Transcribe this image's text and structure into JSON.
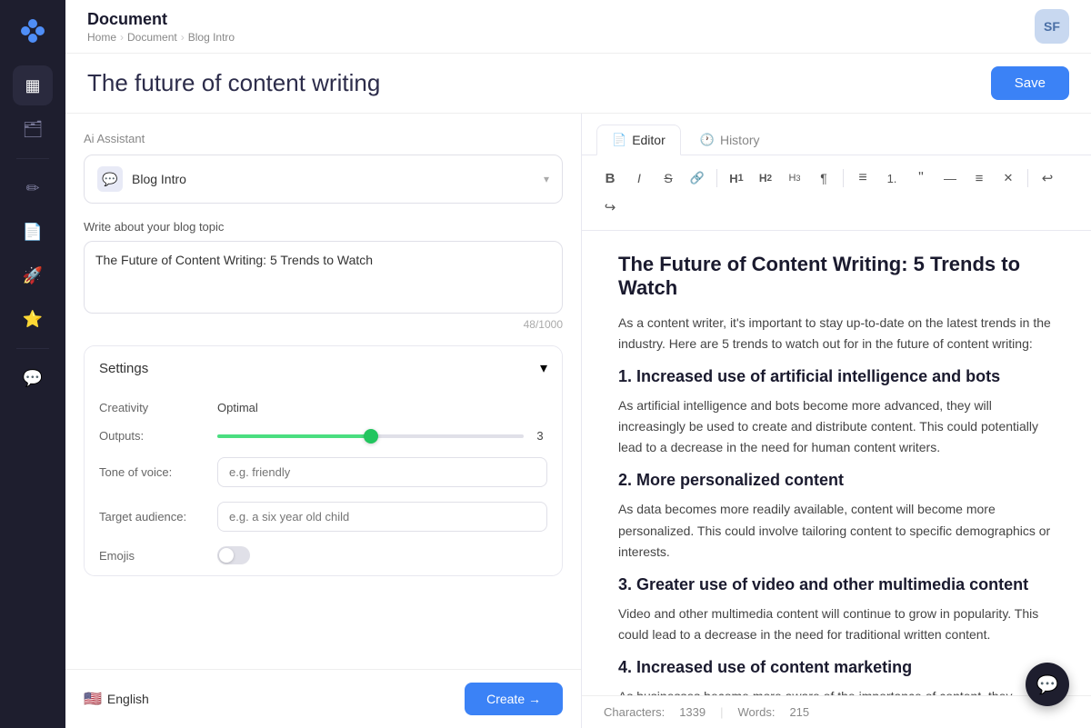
{
  "app": {
    "logo_label": "AI Logo"
  },
  "sidebar": {
    "items": [
      {
        "id": "dashboard",
        "icon": "▦",
        "label": "Dashboard"
      },
      {
        "id": "documents",
        "icon": "🗂",
        "label": "Documents",
        "active": true
      },
      {
        "id": "edit",
        "icon": "✏",
        "label": "Edit"
      },
      {
        "id": "pages",
        "icon": "📄",
        "label": "Pages"
      },
      {
        "id": "rocket",
        "icon": "🚀",
        "label": "Rocket"
      },
      {
        "id": "star",
        "icon": "⭐",
        "label": "Favorites"
      },
      {
        "id": "chat",
        "icon": "💬",
        "label": "Chat"
      }
    ]
  },
  "header": {
    "title": "Document",
    "breadcrumb": {
      "home": "Home",
      "document": "Document",
      "current": "Blog Intro"
    },
    "avatar": "SF"
  },
  "page": {
    "title": "The future of content writing",
    "save_button": "Save"
  },
  "left_panel": {
    "ai_assistant_label": "Ai Assistant",
    "template_selector": {
      "icon": "💬",
      "name": "Blog Intro"
    },
    "topic_label": "Write about your blog topic",
    "topic_value": "The Future of Content Writing: 5 Trends to Watch",
    "topic_placeholder": "",
    "char_count": "48/1000",
    "settings": {
      "label": "Settings",
      "creativity_label": "Creativity",
      "creativity_value": "Optimal",
      "outputs_label": "Outputs:",
      "outputs_value": 3,
      "outputs_slider_pct": 50,
      "tone_label": "Tone of voice:",
      "tone_placeholder": "e.g. friendly",
      "target_label": "Target audience:",
      "target_placeholder": "e.g. a six year old child",
      "emojis_label": "Emojis"
    },
    "language": "English",
    "create_button": "Create →"
  },
  "editor": {
    "tabs": [
      {
        "id": "editor",
        "label": "Editor",
        "icon": "📄",
        "active": true
      },
      {
        "id": "history",
        "label": "History",
        "icon": "🕐",
        "active": false
      }
    ],
    "toolbar": {
      "bold": "B",
      "italic": "I",
      "strikethrough": "S̶",
      "link": "🔗",
      "h1": "H1",
      "h2": "H2",
      "h3": "H3",
      "paragraph": "¶",
      "ul": "≡",
      "ol": "1.",
      "quote": "❝",
      "divider": "—",
      "align": "≡",
      "clear": "✕",
      "undo": "↩",
      "redo": "↪"
    },
    "content": {
      "main_heading": "The Future of Content Writing: 5 Trends to Watch",
      "intro": "As a content writer, it's important to stay up-to-date on the latest trends in the industry. Here are 5 trends to watch out for in the future of content writing:",
      "sections": [
        {
          "heading": "1. Increased use of artificial intelligence and bots",
          "body": "As artificial intelligence and bots become more advanced, they will increasingly be used to create and distribute content. This could potentially lead to a decrease in the need for human content writers."
        },
        {
          "heading": "2. More personalized content",
          "body": "As data becomes more readily available, content will become more personalized. This could involve tailoring content to specific demographics or interests."
        },
        {
          "heading": "3. Greater use of video and other multimedia content",
          "body": "Video and other multimedia content will continue to grow in popularity. This could lead to a decrease in the need for traditional written content."
        },
        {
          "heading": "4. Increased use of content marketing",
          "body": "As businesses become more aware of the importance of content, they"
        }
      ]
    },
    "footer": {
      "characters_label": "Characters:",
      "characters_value": "1339",
      "words_label": "Words:",
      "words_value": "215"
    }
  },
  "chat": {
    "icon": "💬"
  }
}
